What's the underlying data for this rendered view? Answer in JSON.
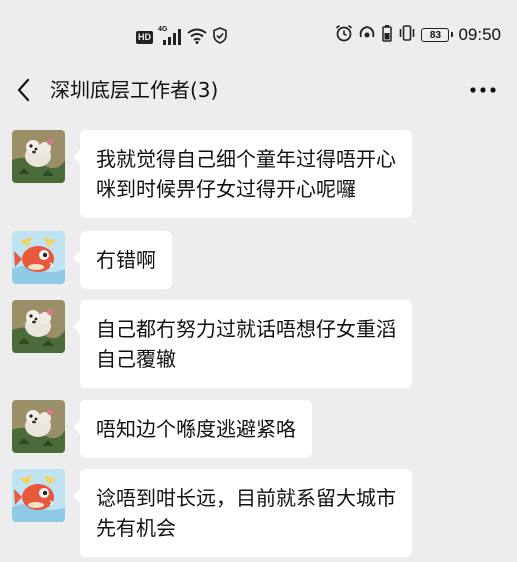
{
  "status_bar": {
    "hd_badge": "HD",
    "network": "4G",
    "battery_level": "83",
    "time": "09:50",
    "left_icons": [
      "hd-icon",
      "signal-icon",
      "wifi-icon",
      "shield-icon"
    ],
    "right_icons": [
      "alarm-icon",
      "hotspot-icon",
      "battery-saver-icon",
      "vibrate-icon",
      "battery-icon"
    ]
  },
  "title_bar": {
    "title": "深圳底层工作者(3)",
    "back_icon": "chevron-left-icon",
    "more_icon": "more-dots-icon"
  },
  "messages": [
    {
      "sender": "dog-avatar",
      "text": "我就觉得自己细个童年过得唔开心\n咪到时候畀仔女过得开心呢囉"
    },
    {
      "sender": "fish-avatar",
      "text": "冇错啊"
    },
    {
      "sender": "dog-avatar",
      "text": "自己都冇努力过就话唔想仔女重滔\n自己覆辙"
    },
    {
      "sender": "dog-avatar",
      "text": "唔知边个喺度逃避紧咯"
    },
    {
      "sender": "fish-avatar",
      "text": "谂唔到咁长远，目前就系留大城市\n先有机会"
    }
  ],
  "colors": {
    "background": "#ededed",
    "bubble": "#ffffff",
    "text": "#111111"
  }
}
